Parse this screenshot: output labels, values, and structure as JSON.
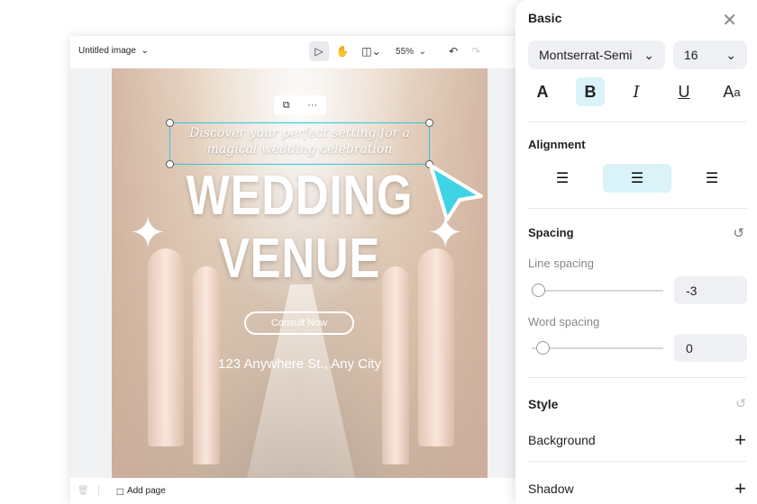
{
  "editor": {
    "title": "Untitled image",
    "zoom": "55%",
    "add_page": "Add page"
  },
  "canvas": {
    "tagline": "Discover your perfect setting for a magical wedding celebration",
    "headline1": "WEDDING",
    "headline2": "VENUE",
    "button": "Consult Now",
    "address": "123 Anywhere St., Any City"
  },
  "panel": {
    "title": "Basic",
    "font": "Montserrat-Semi",
    "size": "16",
    "alignment": "Alignment",
    "spacing": "Spacing",
    "line_spacing_label": "Line spacing",
    "line_spacing": "-3",
    "word_spacing_label": "Word spacing",
    "word_spacing": "0",
    "line_spacing_fraction": 0.05,
    "word_spacing_fraction": 0.08,
    "style": "Style",
    "background": "Background",
    "shadow": "Shadow",
    "accent": "#2fc7e0"
  }
}
